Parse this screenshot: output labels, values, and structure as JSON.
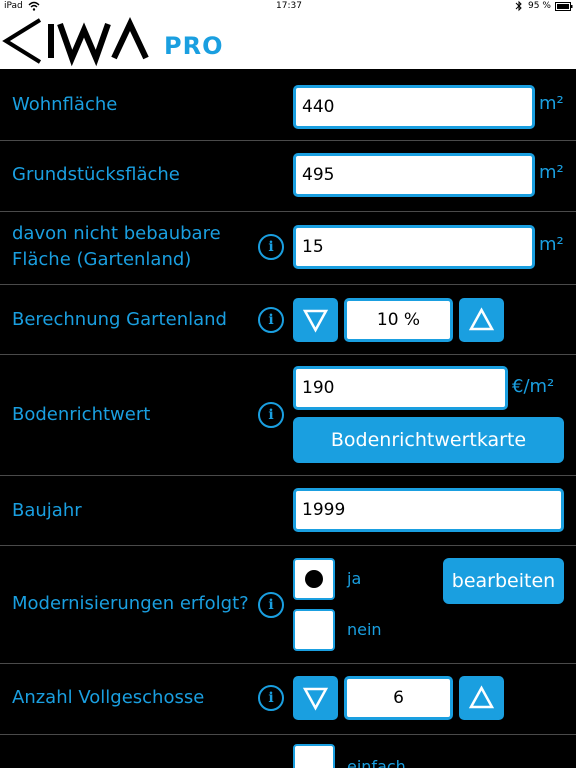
{
  "statusbar": {
    "device": "iPad",
    "time": "17:37",
    "battery": "95 %"
  },
  "header": {
    "logo_text": "IWA",
    "logo_suffix": "PRO"
  },
  "form": {
    "wohnflaeche": {
      "label": "Wohnfläche",
      "value": "440",
      "unit": "m²"
    },
    "grundstuecksflaeche": {
      "label": "Grundstücksfläche",
      "value": "495",
      "unit": "m²"
    },
    "nicht_bebaubar": {
      "label_line1": "davon nicht bebaubare",
      "label_line2": "Fläche (Gartenland)",
      "value": "15",
      "unit": "m²"
    },
    "gartenland": {
      "label": "Berechnung Gartenland",
      "value": "10 %"
    },
    "bodenrichtwert": {
      "label": "Bodenrichtwert",
      "value": "190",
      "unit": "€/m²",
      "button": "Bodenrichtwertkarte"
    },
    "baujahr": {
      "label": "Baujahr",
      "value": "1999"
    },
    "modernisierung": {
      "label": "Modernisierungen erfolgt?",
      "option_yes": "ja",
      "option_no": "nein",
      "selected": "ja",
      "button": "bearbeiten"
    },
    "vollgeschosse": {
      "label": "Anzahl Vollgeschosse",
      "value": "6"
    },
    "ausstattung": {
      "option_simple": "einfach"
    }
  },
  "icons": {
    "info": "info-circle-icon",
    "down": "triangle-down-icon",
    "up": "triangle-up-icon",
    "bluetooth": "bluetooth-icon",
    "battery": "battery-icon",
    "wifi": "wifi-icon"
  },
  "colors": {
    "accent": "#1a9fe0",
    "background": "#000000",
    "field": "#ffffff"
  }
}
